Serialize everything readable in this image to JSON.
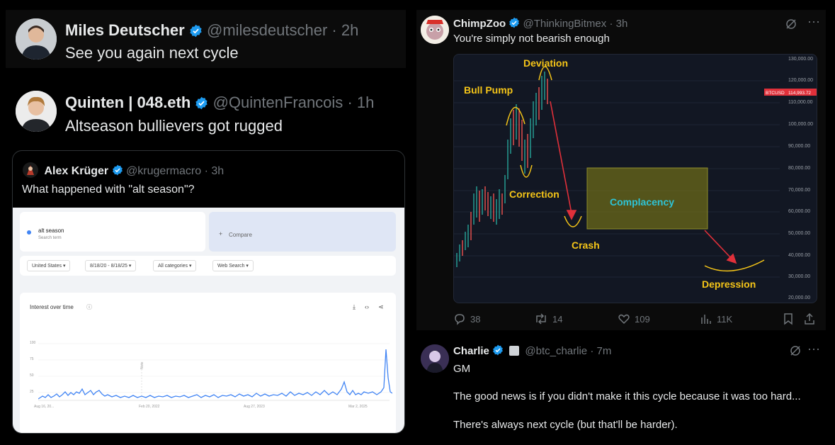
{
  "tweets": {
    "miles": {
      "name": "Miles Deutscher",
      "handle": "@milesdeutscher",
      "time": "· 2h",
      "text": "See you again next cycle"
    },
    "quinten": {
      "name": "Quinten | 048.eth",
      "handle": "@QuintenFrancois",
      "time": "· 1h",
      "text": "Altseason bullievers got rugged"
    },
    "alex": {
      "name": "Alex Krüger",
      "handle": "@krugermacro",
      "time": "· 3h",
      "text": "What happened with \"alt season\"?"
    },
    "chimp": {
      "name": "ChimpZoo",
      "handle": "@ThinkingBitmex",
      "time": "· 3h",
      "text": "You're simply not bearish enough"
    },
    "charlie": {
      "name": "Charlie",
      "handle": "@btc_charlie",
      "time": "· 7m",
      "line1": "GM",
      "line2": "The good news is if you didn't make it this cycle because it was too hard...",
      "line3": "There's always next cycle (but that'll be harder)."
    }
  },
  "trends": {
    "term": "alt season",
    "term_sub": "Search term",
    "compare": "Compare",
    "filters": [
      "United States ▾",
      "8/18/20 - 8/18/25 ▾",
      "All categories ▾",
      "Web Search ▾"
    ],
    "panel_title": "Interest over time",
    "y_ticks": [
      "100",
      "75",
      "50",
      "25"
    ],
    "x_ticks": [
      "Aug 16, 20...",
      "Feb 20, 2022",
      "Aug 27, 2023",
      "Mar 2, 2025"
    ],
    "note": "Note"
  },
  "annotated_chart": {
    "labels": {
      "deviation": "Deviation",
      "bull_pump": "Bull Pump",
      "correction": "Correction",
      "crash": "Crash",
      "complacency": "Complacency",
      "depression": "Depression"
    },
    "y_axis": [
      "130,000.00",
      "120,000.00",
      "110,000.00",
      "100,000.00",
      "90,000.00",
      "80,000.00",
      "70,000.00",
      "60,000.00",
      "50,000.00",
      "40,000.00",
      "30,000.00",
      "20,000.00"
    ],
    "price_tag": {
      "symbol": "BTCUSD",
      "value": "114,993.72"
    }
  },
  "actions": {
    "replies": "38",
    "reposts": "14",
    "likes": "109",
    "views": "11K"
  },
  "colors": {
    "verified": "#1d9bf0",
    "annotation": "#f5c518",
    "arrow": "#e0303a",
    "complacency_box": "#6b6a1a",
    "complacency_text": "#2ec4d6"
  }
}
